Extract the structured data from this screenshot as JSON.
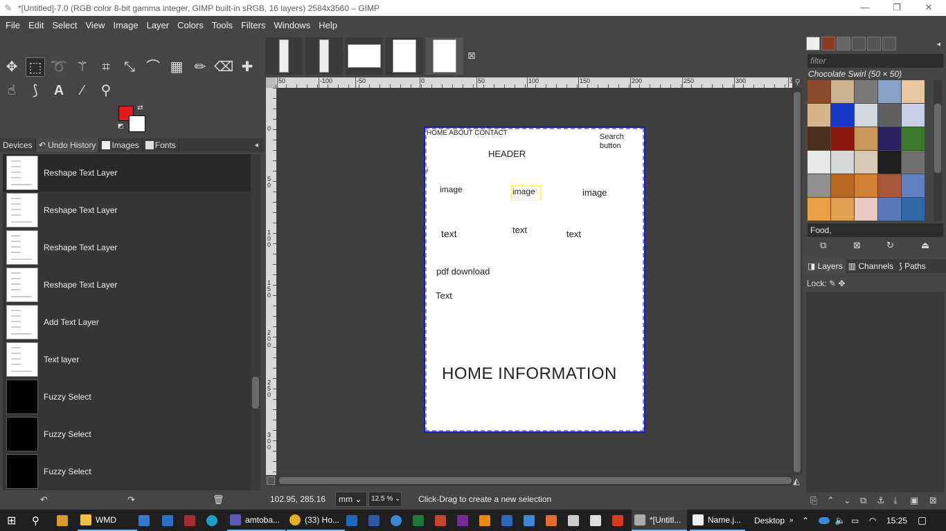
{
  "window": {
    "title": "*[Untitled]-7.0 (RGB color 8-bit gamma integer, GIMP built-in sRGB, 16 layers) 2584x3560 – GIMP",
    "minimize": "—",
    "restore": "❐",
    "close": "✕"
  },
  "menu": [
    "File",
    "Edit",
    "Select",
    "View",
    "Image",
    "Layer",
    "Colors",
    "Tools",
    "Filters",
    "Windows",
    "Help"
  ],
  "colors": {
    "foreground": "#e01b1b",
    "background": "#ffffff"
  },
  "left_dock": {
    "tabs": [
      "Devices",
      "Undo History",
      "Images",
      "Fonts"
    ],
    "history": [
      {
        "label": "Reshape Text Layer",
        "thumb": "white",
        "selected": true
      },
      {
        "label": "Reshape Text Layer",
        "thumb": "white"
      },
      {
        "label": "Reshape Text Layer",
        "thumb": "white"
      },
      {
        "label": "Reshape Text Layer",
        "thumb": "white"
      },
      {
        "label": "Add Text Layer",
        "thumb": "white"
      },
      {
        "label": "Text layer",
        "thumb": "white"
      },
      {
        "label": "Fuzzy Select",
        "thumb": "black"
      },
      {
        "label": "Fuzzy Select",
        "thumb": "black"
      },
      {
        "label": "Fuzzy Select",
        "thumb": "black"
      }
    ],
    "undo": "↶",
    "redo": "↷",
    "clear": "🗑"
  },
  "ruler": {
    "top_labels": [
      "50",
      "-100",
      "-50",
      "0",
      "50",
      "100",
      "150",
      "200",
      "250",
      "300",
      "35"
    ],
    "left_labels": [
      "0",
      "5 0",
      "1 0 0",
      "1 5 0",
      "2 0 0",
      "2 5 0",
      "3 0 0"
    ]
  },
  "document": {
    "nav": "HOME ABOUT CONTACT",
    "search": "Search button",
    "header": "HEADER",
    "marker": "i",
    "image1": "image",
    "image2": "image",
    "image3": "image",
    "text1": "text",
    "text2": "text",
    "text3": "text",
    "pdf": "pdf download",
    "text4": "Text",
    "home_info": "HOME INFORMATION"
  },
  "status": {
    "coords": "102.95, 285.16",
    "unit": "mm",
    "zoom": "12.5 %",
    "message": "Click-Drag to create a new selection"
  },
  "patterns": {
    "filter_placeholder": "filter",
    "selected": "Chocolate Swirl (50 × 50)",
    "tag": "Food,",
    "swatches": [
      "#8b4a2c",
      "#c8b48e",
      "#7a7a7a",
      "#8aa0c8",
      "#e8c8a0",
      "#d8b48a",
      "#1838c8",
      "#d0d8e0",
      "#606060",
      "#c8d0e8",
      "#4a3020",
      "#8a1810",
      "#c89858",
      "#2a2060",
      "#3a7a2a",
      "#e8e8e8",
      "#d8d8d8",
      "#d8c8b8",
      "#202020",
      "#707070",
      "#909090",
      "#b86820",
      "#d08030",
      "#a85838",
      "#6080c0",
      "#e8a040",
      "#e0a050",
      "#e8c8c0",
      "#5878b8",
      "#3068a8"
    ]
  },
  "layers_dock": {
    "tabs": [
      "Layers",
      "Channels",
      "Paths"
    ],
    "lock_label": "Lock:"
  },
  "taskbar": {
    "items": [
      "WMD",
      "amtoba...",
      "(33) Ho...",
      "*[Untitl...",
      "Name.j..."
    ],
    "desktop": "Desktop",
    "time": "15:25"
  }
}
